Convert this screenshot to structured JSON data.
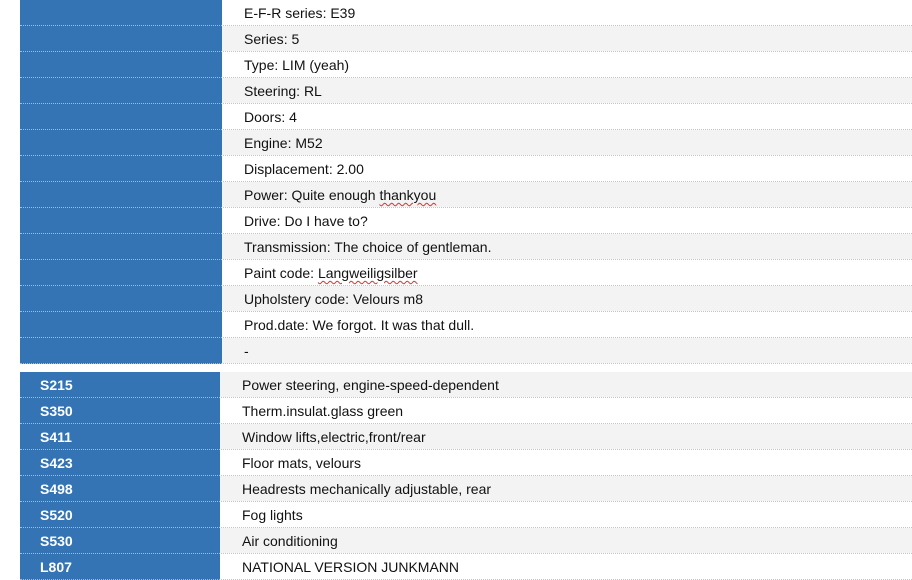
{
  "specs": [
    {
      "label": "E-F-R series",
      "value": "E39"
    },
    {
      "label": "Series",
      "value": "5"
    },
    {
      "label": "Type",
      "value": "LIM (yeah)"
    },
    {
      "label": "Steering",
      "value": "RL"
    },
    {
      "label": "Doors",
      "value": "4"
    },
    {
      "label": "Engine",
      "value": "M52"
    },
    {
      "label": "Displacement",
      "value": "2.00"
    },
    {
      "label": "Power",
      "value": "Quite enough ",
      "value_flagged": "thankyou"
    },
    {
      "label": "Drive",
      "value": "Do I have to?"
    },
    {
      "label": "Transmission",
      "value": "The choice of gentleman."
    },
    {
      "label": "Paint code",
      "value": "",
      "value_flagged": "Langweiligsilber"
    },
    {
      "label": "Upholstery code",
      "value": "Velours m8"
    },
    {
      "label": "Prod.date",
      "value": "We forgot. It was that dull."
    },
    {
      "label": "",
      "value": "-"
    }
  ],
  "options": [
    {
      "code": "S215",
      "desc": "Power steering, engine-speed-dependent"
    },
    {
      "code": "S350",
      "desc": "Therm.insulat.glass green"
    },
    {
      "code": "S411",
      "desc": "Window lifts,electric,front/rear"
    },
    {
      "code": "S423",
      "desc": "Floor mats, velours"
    },
    {
      "code": "S498",
      "desc": "Headrests mechanically adjustable, rear"
    },
    {
      "code": "S520",
      "desc": "Fog lights"
    },
    {
      "code": "S530",
      "desc": "Air conditioning"
    },
    {
      "code": "L807",
      "desc": "NATIONAL VERSION JUNKMANN"
    }
  ],
  "colors": {
    "accent": "#3474b4",
    "row_alt": "#f3f3f3",
    "spellcheck": "#e03030"
  }
}
